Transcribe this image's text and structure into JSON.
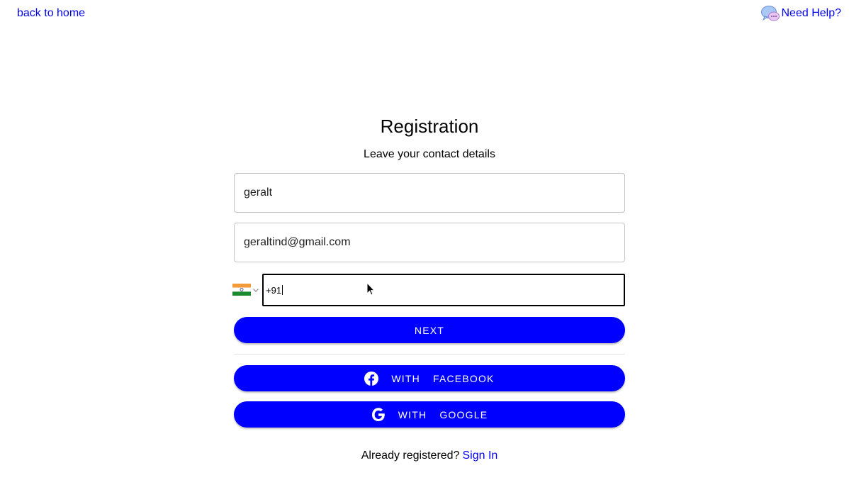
{
  "nav": {
    "back_label": "back to home",
    "help_label": "Need Help?"
  },
  "form": {
    "title": "Registration",
    "subtitle": "Leave your contact details",
    "name_value": "geralt",
    "email_value": "geraltind@gmail.com",
    "phone_value": "+91",
    "country_flag": "india-flag-icon",
    "next_label": "NEXT",
    "facebook_with": "WITH",
    "facebook_label": "FACEBOOK",
    "google_with": "WITH",
    "google_label": "GOOGLE"
  },
  "footer": {
    "already_text": "Already registered?",
    "signin_label": "Sign In"
  },
  "colors": {
    "accent": "#0000ff",
    "link": "#0000ee"
  }
}
